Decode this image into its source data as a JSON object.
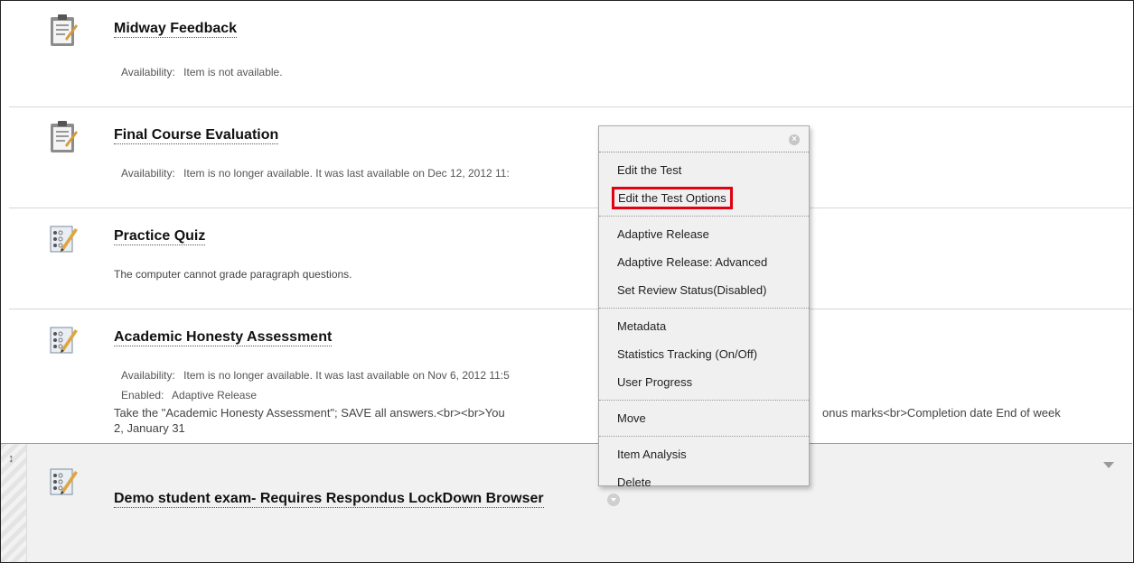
{
  "items": [
    {
      "title": "Midway Feedback",
      "icon": "survey-clipboard-icon",
      "availability_label": "Availability:",
      "availability_value": "Item is not available."
    },
    {
      "title": "Final Course Evaluation",
      "icon": "survey-clipboard-icon",
      "availability_label": "Availability:",
      "availability_value": "Item is no longer available. It was last available on Dec 12, 2012 11:"
    },
    {
      "title": "Practice Quiz",
      "icon": "test-pencil-icon",
      "description": "The computer cannot grade paragraph questions."
    },
    {
      "title": "Academic Honesty Assessment",
      "icon": "test-pencil-icon",
      "availability_label": "Availability:",
      "availability_value": "Item is no longer available. It was last available on Nov 6, 2012 11:5",
      "enabled_label": "Enabled:",
      "enabled_value": "Adaptive Release",
      "description_left": "Take the \"Academic Honesty Assessment\"; SAVE all answers.<br><br>You",
      "description_right": "onus marks<br>Completion date End of week",
      "description_line2": "2, January 31"
    },
    {
      "title": "Demo student exam- Requires Respondus LockDown Browser",
      "icon": "test-pencil-icon",
      "drag_handle": "↕"
    }
  ],
  "menu": {
    "close_icon": "close-circle-icon",
    "close_glyph": "×",
    "groups": [
      [
        "Edit the Test",
        "Edit the Test Options"
      ],
      [
        "Adaptive Release",
        "Adaptive Release: Advanced",
        "Set Review Status(Disabled)"
      ],
      [
        "Metadata",
        "Statistics Tracking (On/Off)",
        "User Progress"
      ],
      [
        "Move"
      ],
      [
        "Item Analysis",
        "Delete"
      ]
    ],
    "highlighted": "Edit the Test Options"
  },
  "colors": {
    "highlight_border": "#e3000f",
    "last_item_bg": "#f1f1f1"
  }
}
